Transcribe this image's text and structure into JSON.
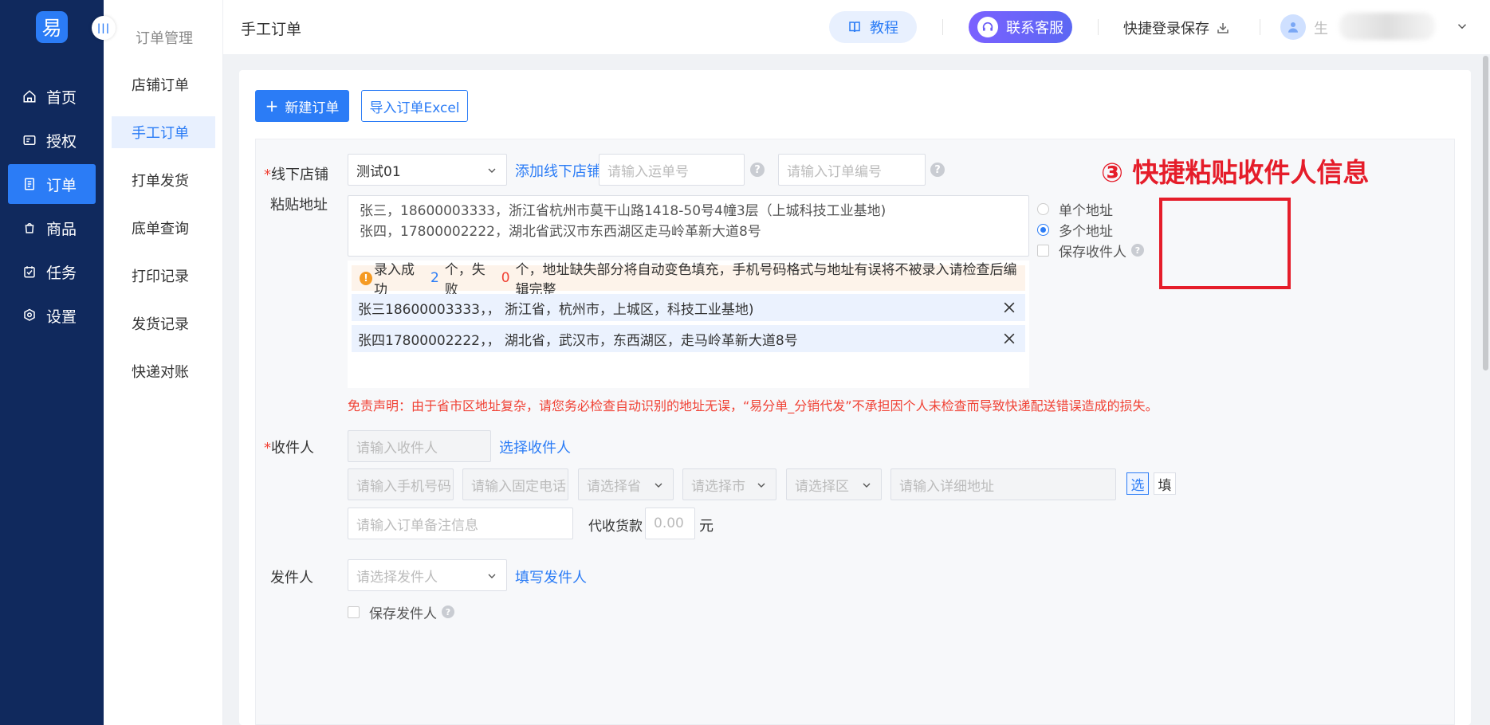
{
  "logo": {
    "text": "易"
  },
  "nav": {
    "items": [
      {
        "label": "首页",
        "icon": "home-icon"
      },
      {
        "label": "授权",
        "icon": "authorize-icon"
      },
      {
        "label": "订单",
        "icon": "order-icon",
        "active": true
      },
      {
        "label": "商品",
        "icon": "goods-icon"
      },
      {
        "label": "任务",
        "icon": "task-icon"
      },
      {
        "label": "设置",
        "icon": "settings-icon"
      }
    ]
  },
  "subnav": {
    "title": "订单管理",
    "items": [
      {
        "label": "店铺订单"
      },
      {
        "label": "手工订单",
        "active": true
      },
      {
        "label": "打单发货"
      },
      {
        "label": "底单查询"
      },
      {
        "label": "打印记录"
      },
      {
        "label": "发货记录"
      },
      {
        "label": "快递对账"
      }
    ]
  },
  "header": {
    "title": "手工订单",
    "tutorial": "教程",
    "support": "联系客服",
    "quick_login": "快捷登录保存",
    "user_initial": "生"
  },
  "actions": {
    "new_order": "新建订单",
    "import_excel": "导入订单Excel"
  },
  "form": {
    "store": {
      "label": "线下店铺",
      "value": "测试01",
      "add_link": "添加线下店铺"
    },
    "tracking_placeholder": "请输入运单号",
    "order_no_placeholder": "请输入订单编号",
    "paste": {
      "label": "粘贴地址",
      "lines": [
        "张三，18600003333，浙江省杭州市莫干山路1418-50号4幢3层（上城科技工业基地)",
        "张四，17800002222，湖北省武汉市东西湖区走马岭革新大道8号"
      ]
    },
    "result": {
      "prefix": "录入成功",
      "success_count": "2",
      "mid": "个，失败",
      "fail_count": "0",
      "suffix": "个，地址缺失部分将自动变色填充，手机号码格式与地址有误将不被录入请检查后编辑完整",
      "rows": [
        "张三18600003333，， 浙江省，杭州市，上城区，科技工业基地)",
        "张四17800002222，， 湖北省，武汉市，东西湖区，走马岭革新大道8号"
      ]
    },
    "options": {
      "single": "单个地址",
      "multiple": "多个地址",
      "save_receiver": "保存收件人"
    },
    "disclaimer": "免责声明：由于省市区地址复杂，请您务必检查自动识别的地址无误，“易分单_分销代发”不承担因个人未检查而导致快递配送错误造成的损失。",
    "receiver": {
      "label": "收件人",
      "placeholder": "请输入收件人",
      "select_link": "选择收件人",
      "phone_placeholder": "请输入手机号码",
      "tel_placeholder": "请输入固定电话",
      "province_placeholder": "请选择省",
      "city_placeholder": "请选择市",
      "district_placeholder": "请选择区",
      "address_placeholder": "请输入详细地址",
      "btn_select": "选",
      "btn_fill": "填",
      "remark_placeholder": "请输入订单备注信息",
      "cod_label": "代收货款",
      "cod_value": "0.00",
      "cod_unit": "元"
    },
    "sender": {
      "label": "发件人",
      "placeholder": "请选择发件人",
      "fill_link": "填写发件人",
      "save_label": "保存发件人"
    }
  },
  "annotation": {
    "text": "③ 快捷粘贴收件人信息",
    "color": "#e51d2a"
  },
  "colors": {
    "primary": "#2b7cf6",
    "sidebar": "#10295d",
    "error": "#f04134"
  }
}
